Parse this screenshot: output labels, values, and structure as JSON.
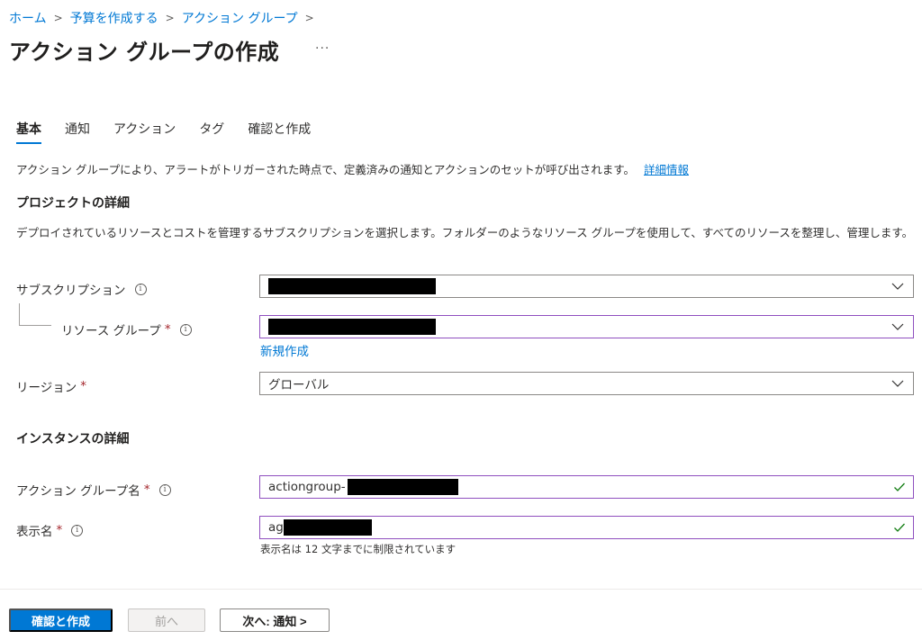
{
  "breadcrumb": {
    "items": [
      "ホーム",
      "予算を作成する",
      "アクション グループ"
    ],
    "separator": ">"
  },
  "title": "アクション グループの作成",
  "more_label": "···",
  "tabs": [
    "基本",
    "通知",
    "アクション",
    "タグ",
    "確認と作成"
  ],
  "active_tab": "基本",
  "intro": {
    "text": "アクション グループにより、アラートがトリガーされた時点で、定義済みの通知とアクションのセットが呼び出されます。",
    "link": "詳細情報"
  },
  "project": {
    "heading": "プロジェクトの詳細",
    "description": "デプロイされているリソースとコストを管理するサブスクリプションを選択します。フォルダーのようなリソース グループを使用して、すべてのリソースを整理し、管理します。"
  },
  "form": {
    "subscription_label": "サブスクリプション",
    "resource_group_label": "リソース グループ",
    "new_link": "新規作成",
    "region_label": "リージョン",
    "region_value": "グローバル",
    "required_mark": "*",
    "info_glyph": "i"
  },
  "instance": {
    "heading": "インスタンスの詳細",
    "action_group_name_label": "アクション グループ名",
    "action_group_name_value": "actiongroup-",
    "display_name_label": "表示名",
    "display_name_value": "ag",
    "display_name_hint": "表示名は 12 文字までに制限されています"
  },
  "footer": {
    "review_button": "確認と作成",
    "prev_button": "前へ",
    "next_button": "次へ: 通知 >"
  },
  "colors": {
    "accent": "#0078d4",
    "required": "#a4262c",
    "focus_border": "#8f4fbf",
    "valid_check": "#107c10"
  },
  "icons": [
    "chevron-right-icon",
    "more-icon",
    "info-icon",
    "chevron-down-icon",
    "checkmark-icon"
  ]
}
